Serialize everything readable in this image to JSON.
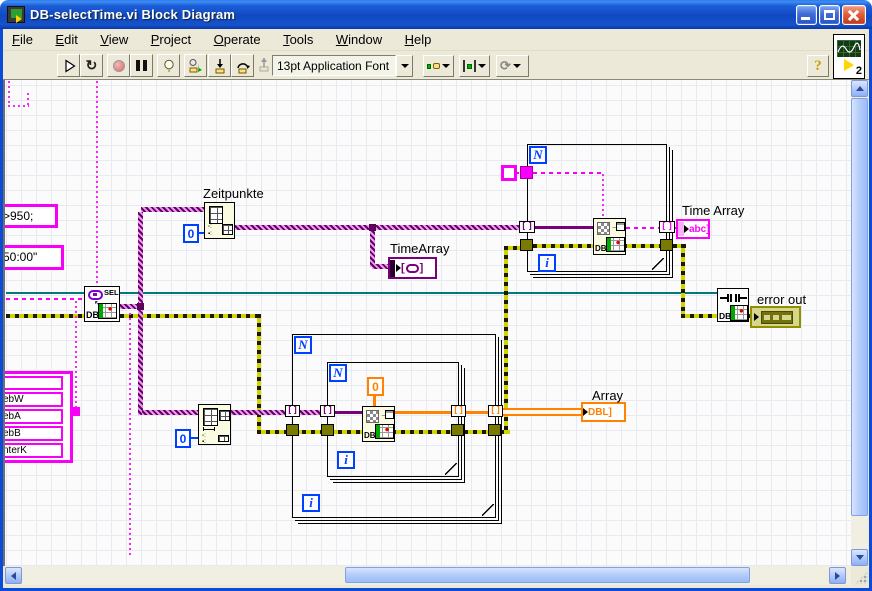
{
  "window": {
    "title": "DB-selectTime.vi Block Diagram",
    "control_icons": [
      "minimize-icon",
      "maximize-icon",
      "close-icon"
    ]
  },
  "menu": {
    "items": [
      "File",
      "Edit",
      "View",
      "Project",
      "Operate",
      "Tools",
      "Window",
      "Help"
    ]
  },
  "toolbar": {
    "font_selector": "13pt Application Font",
    "help_label": "?",
    "vi_icon_badge": "2",
    "button_icons": [
      "run",
      "run-continuously",
      "abort-execution",
      "pause",
      "highlight-execution",
      "retain-wire-values",
      "step-into",
      "step-over",
      "step-out",
      "align-objects",
      "distribute-objects",
      "reorder"
    ]
  },
  "diagram": {
    "labels": {
      "zeitpunkte": "Zeitpunkte",
      "time_array_local": "TimeArray",
      "time_array_indicator": "Time Array",
      "array_indicator": "Array",
      "error_out": "error out"
    },
    "constants": {
      "string_partial_1": ">950;",
      "string_partial_2": "50:00\"",
      "index_zero_top": "0",
      "index_zero_bottom": "0",
      "column_zero": "0"
    },
    "cluster_items": [
      "",
      "ebW",
      "ebA",
      "ebB",
      "nterK"
    ],
    "glyphs": {
      "N": "N",
      "i": "i",
      "DB": "DB",
      "SEL": "SEL",
      "string_array": "abc]",
      "dbl_array": "DBL]"
    },
    "colors": {
      "string_pink": "#F800F8",
      "cluster_purple": "#7A007A",
      "error_olive": "#D2D200",
      "numeric_orange": "#FF8200",
      "int_blue": "#0040FF",
      "refnum_teal": "#007B7B"
    }
  }
}
